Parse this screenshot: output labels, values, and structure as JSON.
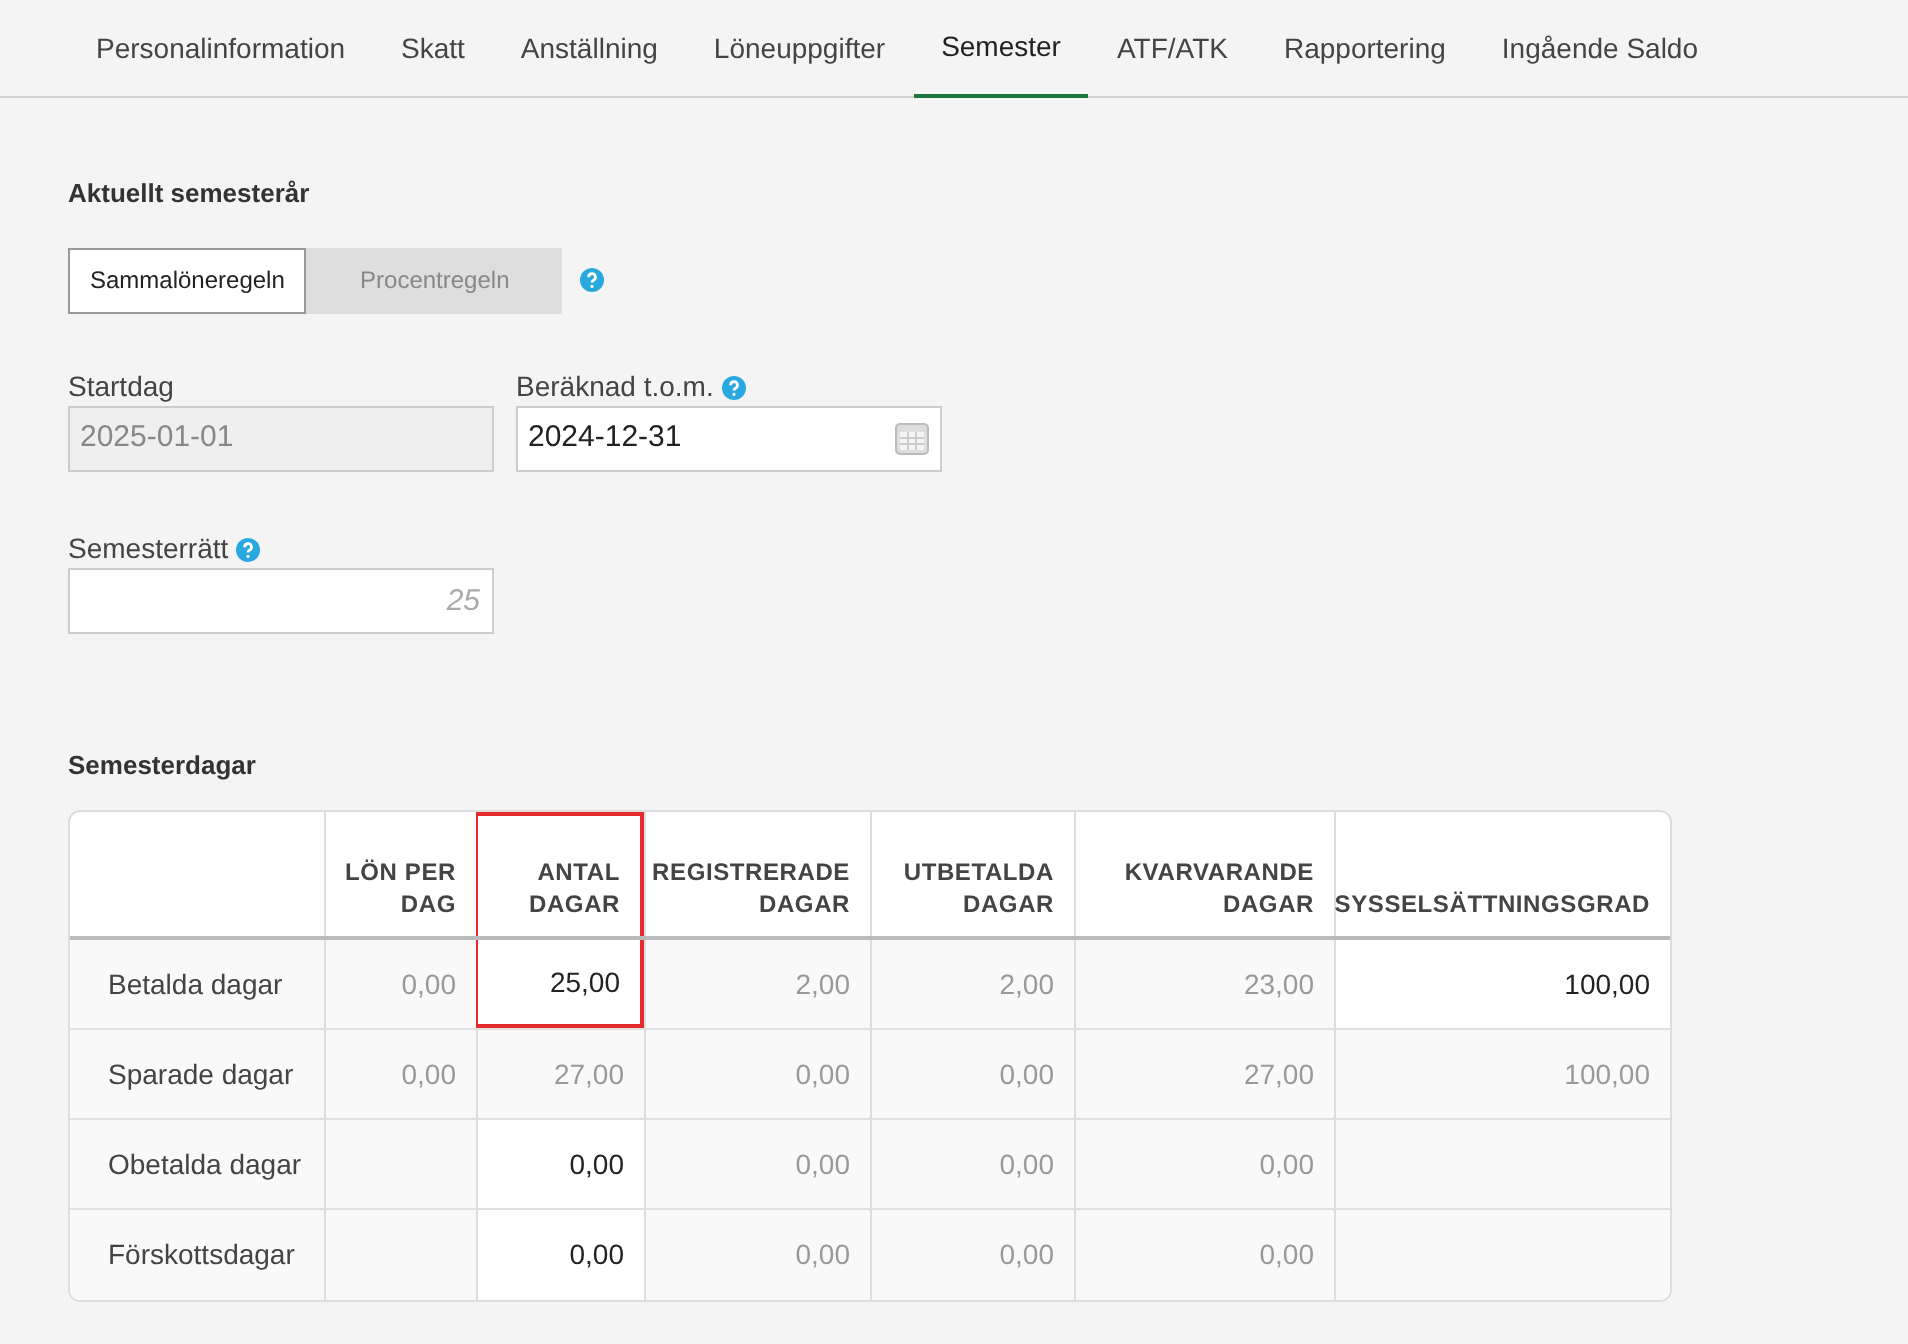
{
  "tabs": [
    {
      "label": "Personalinformation",
      "selected": false
    },
    {
      "label": "Skatt",
      "selected": false
    },
    {
      "label": "Anställning",
      "selected": false
    },
    {
      "label": "Löneuppgifter",
      "selected": false
    },
    {
      "label": "Semester",
      "selected": true
    },
    {
      "label": "ATF/ATK",
      "selected": false
    },
    {
      "label": "Rapportering",
      "selected": false
    },
    {
      "label": "Ingående Saldo",
      "selected": false
    }
  ],
  "current_year": {
    "heading": "Aktuellt semesterår",
    "rules": [
      {
        "label": "Sammalöneregeln",
        "selected": true
      },
      {
        "label": "Procentregeln",
        "selected": false
      }
    ],
    "start": {
      "label": "Startdag",
      "value": "2025-01-01",
      "disabled": true
    },
    "end": {
      "label": "Beräknad t.o.m.",
      "value": "2024-12-31",
      "disabled": false
    },
    "entitlement": {
      "label": "Semesterrätt",
      "placeholder": "25"
    }
  },
  "days": {
    "heading": "Semesterdagar",
    "columns": [
      {
        "label": "LÖN PER DAG",
        "highlighted": false
      },
      {
        "label": "ANTAL DAGAR",
        "highlighted": true
      },
      {
        "label": "REGISTRERADE DAGAR",
        "highlighted": false
      },
      {
        "label": "UTBETALDA DAGAR",
        "highlighted": false
      },
      {
        "label": "KVARVARANDE DAGAR",
        "highlighted": false
      },
      {
        "label": "SYSSELSÄTTNINGSGRAD",
        "highlighted": false
      }
    ],
    "rows": [
      {
        "label": "Betalda dagar",
        "cells": [
          {
            "value": "0,00",
            "editable": false,
            "highlighted": false
          },
          {
            "value": "25,00",
            "editable": true,
            "highlighted": true
          },
          {
            "value": "2,00",
            "editable": false,
            "highlighted": false
          },
          {
            "value": "2,00",
            "editable": false,
            "highlighted": false
          },
          {
            "value": "23,00",
            "editable": false,
            "highlighted": false
          },
          {
            "value": "100,00",
            "editable": true,
            "highlighted": false
          }
        ]
      },
      {
        "label": "Sparade dagar",
        "cells": [
          {
            "value": "0,00",
            "editable": false,
            "highlighted": false
          },
          {
            "value": "27,00",
            "editable": false,
            "highlighted": false
          },
          {
            "value": "0,00",
            "editable": false,
            "highlighted": false
          },
          {
            "value": "0,00",
            "editable": false,
            "highlighted": false
          },
          {
            "value": "27,00",
            "editable": false,
            "highlighted": false
          },
          {
            "value": "100,00",
            "editable": false,
            "highlighted": false
          }
        ]
      },
      {
        "label": "Obetalda dagar",
        "cells": [
          null,
          {
            "value": "0,00",
            "editable": true,
            "highlighted": false
          },
          {
            "value": "0,00",
            "editable": false,
            "highlighted": false
          },
          {
            "value": "0,00",
            "editable": false,
            "highlighted": false
          },
          {
            "value": "0,00",
            "editable": false,
            "highlighted": false
          },
          null
        ]
      },
      {
        "label": "Förskottsdagar",
        "cells": [
          null,
          {
            "value": "0,00",
            "editable": true,
            "highlighted": false
          },
          {
            "value": "0,00",
            "editable": false,
            "highlighted": false
          },
          {
            "value": "0,00",
            "editable": false,
            "highlighted": false
          },
          {
            "value": "0,00",
            "editable": false,
            "highlighted": false
          },
          null
        ]
      }
    ]
  }
}
